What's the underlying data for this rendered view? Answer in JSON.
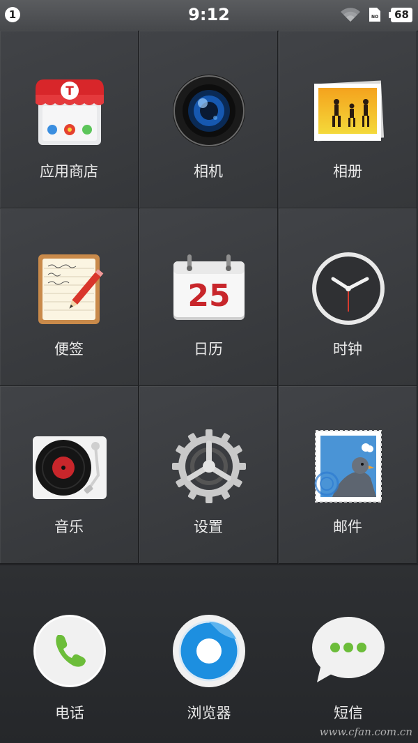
{
  "status_bar": {
    "notification_count": "1",
    "time": "9:12",
    "battery_level": "68",
    "icons": [
      "wifi-icon",
      "sim-no-icon",
      "battery-icon"
    ]
  },
  "apps": [
    {
      "label": "应用商店",
      "icon": "app-store-icon",
      "store_badge": "T"
    },
    {
      "label": "相机",
      "icon": "camera-icon"
    },
    {
      "label": "相册",
      "icon": "gallery-icon"
    },
    {
      "label": "便签",
      "icon": "notes-icon"
    },
    {
      "label": "日历",
      "icon": "calendar-icon",
      "day": "25"
    },
    {
      "label": "时钟",
      "icon": "clock-icon"
    },
    {
      "label": "音乐",
      "icon": "music-icon"
    },
    {
      "label": "设置",
      "icon": "settings-icon"
    },
    {
      "label": "邮件",
      "icon": "mail-icon"
    }
  ],
  "dock": [
    {
      "label": "电话",
      "icon": "phone-icon"
    },
    {
      "label": "浏览器",
      "icon": "browser-icon"
    },
    {
      "label": "短信",
      "icon": "messages-icon"
    }
  ],
  "watermark": "www.cfan.com.cn",
  "colors": {
    "background": "#2b2d30",
    "label_text": "#e9e9e9",
    "calendar_red": "#c8262b",
    "phone_green": "#6cbd3a",
    "browser_blue": "#1d8fe0"
  }
}
